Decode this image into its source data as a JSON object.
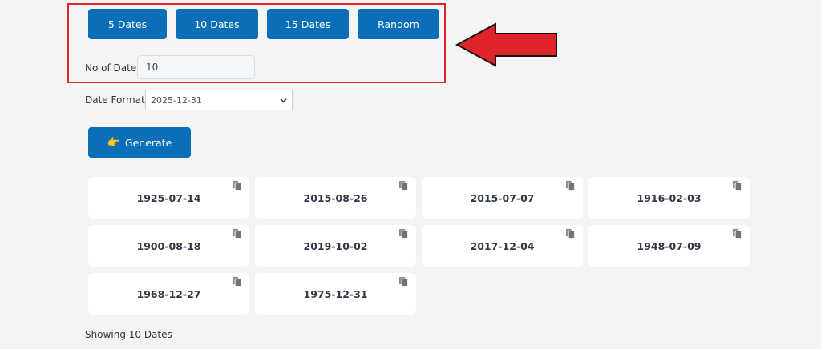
{
  "presets": {
    "btn5": "5 Dates",
    "btn10": "10 Dates",
    "btn15": "15 Dates",
    "random": "Random"
  },
  "count": {
    "label": "No of Date:",
    "value": "10"
  },
  "format": {
    "label": "Date Format:",
    "selected": "2025-12-31"
  },
  "generate": {
    "label": "Generate"
  },
  "results": {
    "dates": [
      "1925-07-14",
      "2015-08-26",
      "2015-07-07",
      "1916-02-03",
      "1900-08-18",
      "2019-10-02",
      "2017-12-04",
      "1948-07-09",
      "1968-12-27",
      "1975-12-31"
    ],
    "summary": "Showing 10 Dates"
  },
  "annotation": {
    "color": "#e0242b"
  },
  "theme": {
    "primary": "#0a6fb8"
  }
}
